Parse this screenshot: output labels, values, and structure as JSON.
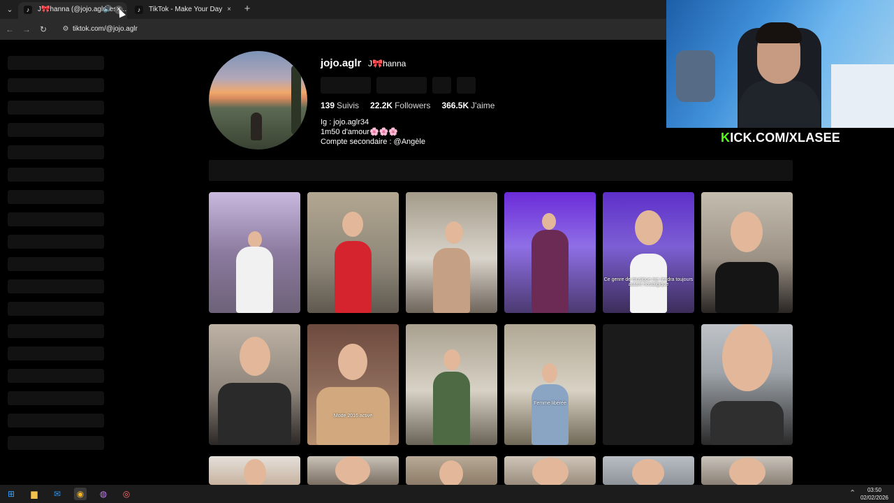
{
  "browser": {
    "tabs": [
      {
        "title": "J🎀hanna (@jojo.aglr) est ...",
        "active": true,
        "audio": true
      },
      {
        "title": "TikTok - Make Your Day",
        "active": false
      }
    ],
    "url": "tiktok.com/@jojo.aglr"
  },
  "profile": {
    "username": "jojo.aglr",
    "nickname": "J🎀hanna",
    "stats": {
      "following_count": "139",
      "following_label": "Suivis",
      "followers_count": "22.2K",
      "followers_label": "Followers",
      "likes_count": "366.5K",
      "likes_label": "J'aime"
    },
    "bio": [
      "Ig : jojo.aglr34",
      "1m50 d'amour🌸🌸🌸",
      "Compte secondaire : @Angèle"
    ]
  },
  "videos": [
    {
      "caption": ""
    },
    {
      "caption": ""
    },
    {
      "caption": ""
    },
    {
      "caption": ""
    },
    {
      "caption": "Ce genre de musique me rendra toujours autant nostalgique"
    },
    {
      "caption": ""
    },
    {
      "caption": ""
    },
    {
      "caption": "Mode 2016 activé"
    },
    {
      "caption": ""
    },
    {
      "caption": "Femme libérée"
    },
    {
      "caption": ""
    },
    {
      "caption": ""
    }
  ],
  "overlay": {
    "kick_k": "K",
    "kick_rest": "ICK.COM/XLASEE"
  },
  "taskbar": {
    "time": "03:50",
    "date": "02/02/2026"
  },
  "icons": {
    "back": "arrow-left-icon",
    "forward": "arrow-right-icon",
    "reload": "reload-icon",
    "site_info": "tune-icon"
  },
  "colors": {
    "kick_green": "#53fc18",
    "background": "#000000"
  }
}
